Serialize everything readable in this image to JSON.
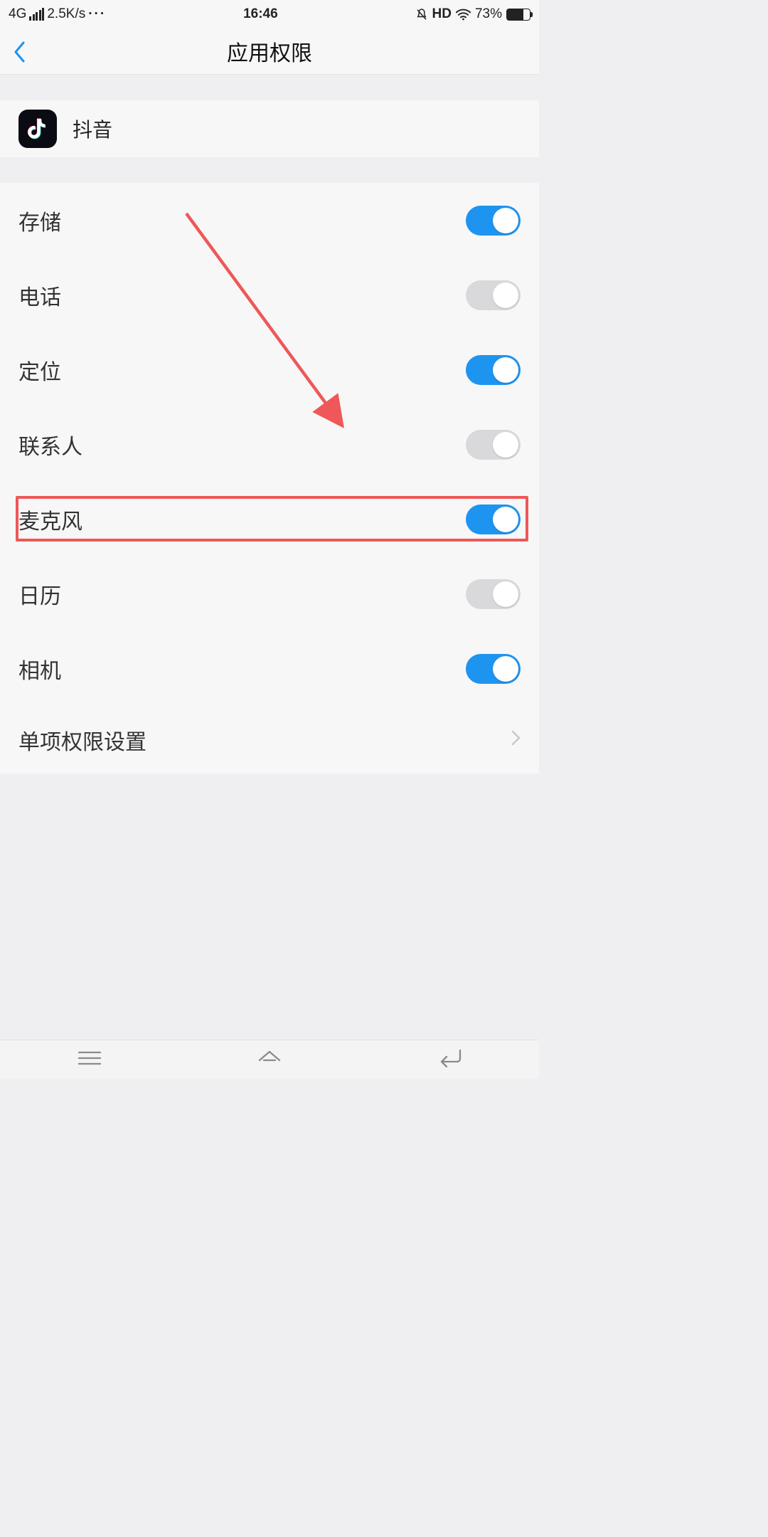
{
  "status": {
    "network": "4G",
    "speed": "2.5K/s",
    "time": "16:46",
    "hd": "HD",
    "battery_pct": "73%"
  },
  "header": {
    "title": "应用权限"
  },
  "app": {
    "name": "抖音"
  },
  "perms": [
    {
      "label": "存储",
      "on": true
    },
    {
      "label": "电话",
      "on": false
    },
    {
      "label": "定位",
      "on": true
    },
    {
      "label": "联系人",
      "on": false
    },
    {
      "label": "麦克风",
      "on": true
    },
    {
      "label": "日历",
      "on": false
    },
    {
      "label": "相机",
      "on": true
    }
  ],
  "more": {
    "label": "单项权限设置"
  },
  "annot": {
    "highlight_index": 4
  }
}
